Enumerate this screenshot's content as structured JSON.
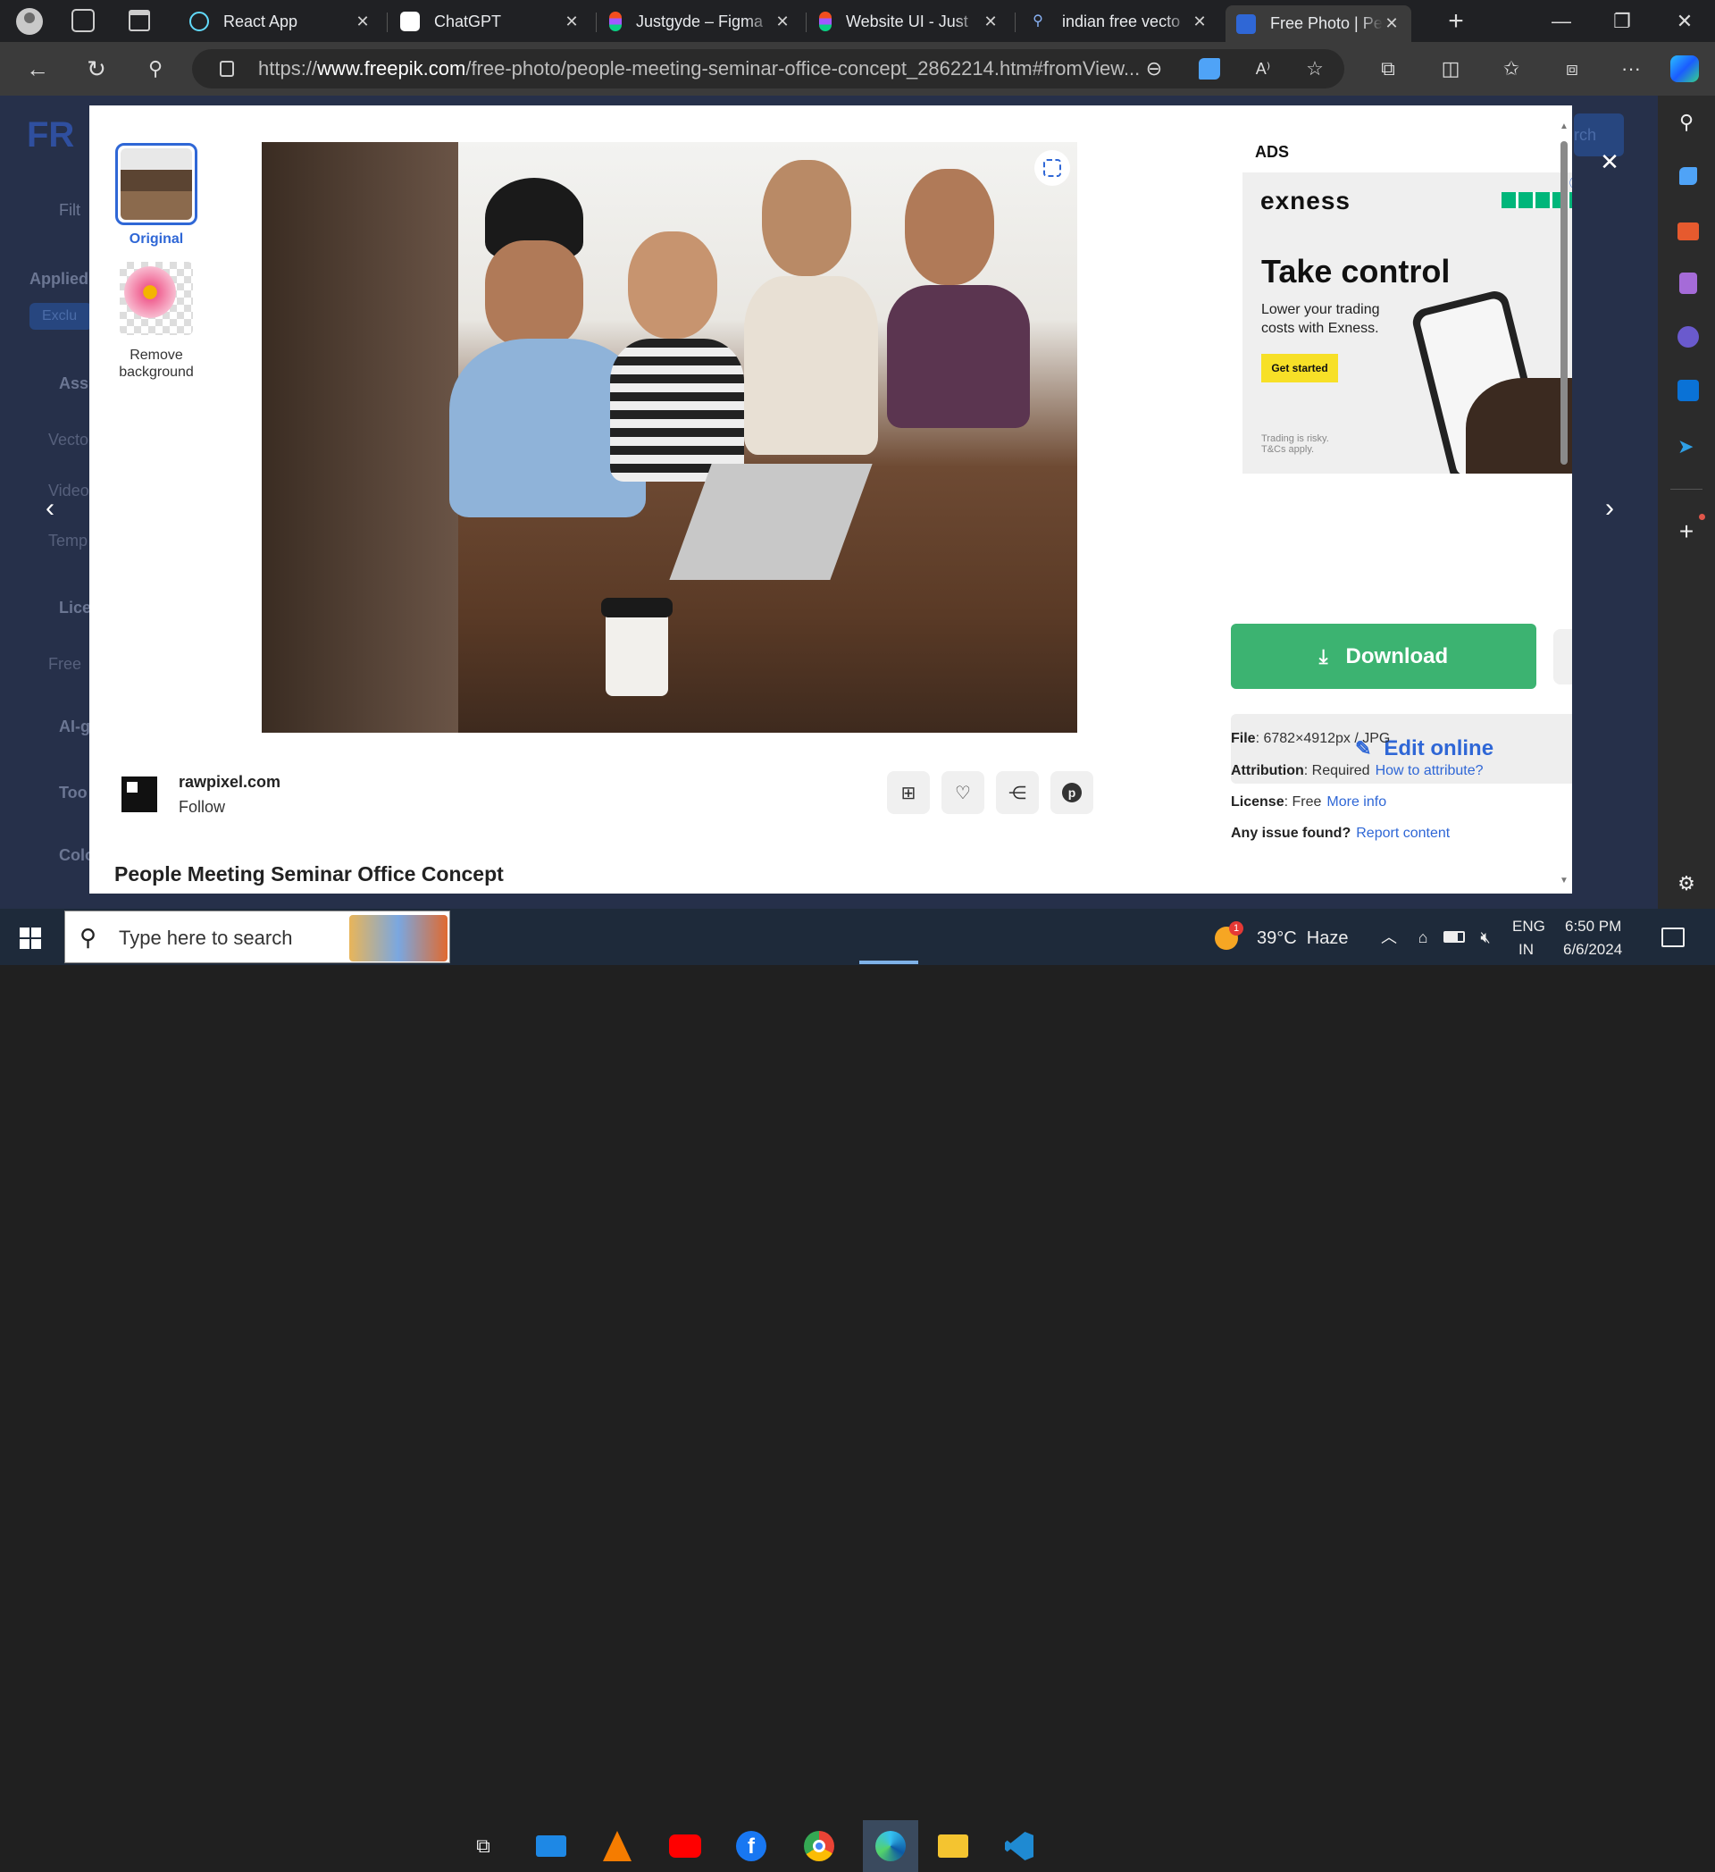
{
  "tabs": [
    {
      "title": "React App",
      "icon": "react-icon"
    },
    {
      "title": "ChatGPT",
      "icon": "chatgpt-icon"
    },
    {
      "title": "Justgyde – Figma",
      "icon": "figma-icon"
    },
    {
      "title": "Website UI - Just",
      "icon": "figma-icon"
    },
    {
      "title": "indian free vecto",
      "icon": "search-icon"
    },
    {
      "title": "Free Photo | Peop",
      "icon": "freepik-icon"
    }
  ],
  "address": {
    "prefix": "https://",
    "domain": "www.freepik.com",
    "path": "/free-photo/people-meeting-seminar-office-concept_2862214.htm#fromView..."
  },
  "backdrop": {
    "left_items": [
      "Filt",
      "Applied",
      "Exclu",
      "Ass",
      "Vecto",
      "Video",
      "Temp",
      "Lice",
      "Free",
      "AI-g",
      "Too",
      "Colo"
    ],
    "search_label": "rch"
  },
  "modal": {
    "variants": [
      {
        "label": "Original"
      },
      {
        "label": "Remove background"
      }
    ],
    "ads_label": "ADS",
    "ad": {
      "brand": "exness",
      "headline": "Take control",
      "body": "Lower your trading costs with Exness.",
      "cta": "Get started",
      "disclaimer": "Trading is risky. T&Cs apply."
    },
    "download_label": "Download",
    "edit_label": "Edit online",
    "file": {
      "label": "File",
      "value": "6782×4912px / JPG"
    },
    "attribution": {
      "label": "Attribution",
      "value": "Required",
      "link": "How to attribute?"
    },
    "license": {
      "label": "License",
      "value": "Free",
      "link": "More info"
    },
    "issue": {
      "label": "Any issue found?",
      "link": "Report content"
    },
    "author": {
      "name": "rawpixel.com",
      "follow": "Follow"
    },
    "title": "People Meeting Seminar Office Concept"
  },
  "taskbar": {
    "search_placeholder": "Type here to search",
    "weather": "39°C  Haze",
    "lang1": "ENG",
    "lang2": "IN",
    "time": "6:50 PM",
    "date": "6/6/2024",
    "badge": "1"
  },
  "colors": {
    "accent": "#2f67d6",
    "download": "#3cb371",
    "backdrop": "#26304a"
  }
}
